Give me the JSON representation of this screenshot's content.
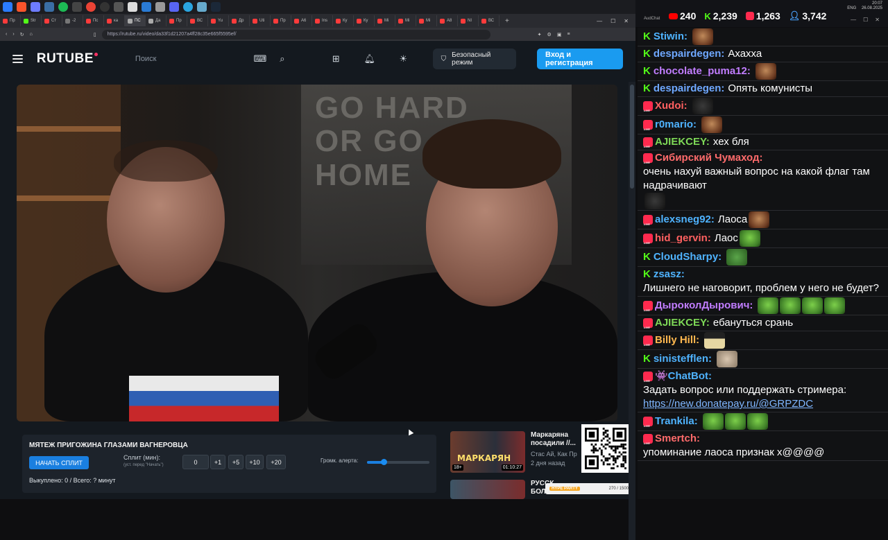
{
  "browser": {
    "tabs": [
      {
        "label": "Пр",
        "color": "#ff3b3b"
      },
      {
        "label": "Str",
        "color": "#53fc18"
      },
      {
        "label": "Ст",
        "color": "#ff3b3b"
      },
      {
        "label": "-2",
        "color": "#777777"
      },
      {
        "label": "Пс",
        "color": "#ff3b3b"
      },
      {
        "label": "ка",
        "color": "#ff3b3b"
      },
      {
        "label": "ПС",
        "color": "#aaaaaa",
        "active": true
      },
      {
        "label": "Да",
        "color": "#aaaaaa"
      },
      {
        "label": "Пр",
        "color": "#ff3b3b"
      },
      {
        "label": "ВС",
        "color": "#ff3b3b"
      },
      {
        "label": "Yu",
        "color": "#ff3b3b"
      },
      {
        "label": "Др",
        "color": "#ff3b3b"
      },
      {
        "label": "Uti",
        "color": "#ff3b3b"
      },
      {
        "label": "Пр",
        "color": "#ff3b3b"
      },
      {
        "label": "А6",
        "color": "#ff3b3b"
      },
      {
        "label": "Ins",
        "color": "#ff3b3b"
      },
      {
        "label": "Ку",
        "color": "#ff3b3b"
      },
      {
        "label": "Ку",
        "color": "#ff3b3b"
      },
      {
        "label": "Mi",
        "color": "#ff3b3b"
      },
      {
        "label": "Mi",
        "color": "#ff3b3b"
      },
      {
        "label": "Mi",
        "color": "#ff3b3b"
      },
      {
        "label": "А8",
        "color": "#ff3b3b"
      },
      {
        "label": "NI",
        "color": "#ff3b3b"
      },
      {
        "label": "ВС",
        "color": "#ff3b3b"
      }
    ],
    "new_tab": "+",
    "url": "https://rutube.ru/video/da33f1d21207a4ff28c35e665f5595ef/"
  },
  "rutube": {
    "logo": "RUTUBE",
    "search_placeholder": "Поиск",
    "safe_mode": "Безопасный режим",
    "login": "Вход и регистрация",
    "poster_text": "GO HARD\nOR GO\nHOME"
  },
  "split": {
    "title": "МЯТЕЖ ПРИГОЖИНА ГЛАЗАМИ ВАГНЕРОВЦА",
    "start": "НАЧАТЬ СПЛИТ",
    "label": "Сплит (мин):",
    "hint": "(уст. перед \"Начать\")",
    "value": "0",
    "buttons": [
      "+1",
      "+5",
      "+10",
      "+20"
    ],
    "alert_label": "Громк. алерта:",
    "alert_volume": 0.27,
    "status": "Выкуплено: 0 / Всего: ? минут"
  },
  "recommendation": {
    "title": "Маркаряна посадили //...",
    "author": "Стас Ай, Как Пр",
    "ago": "2 дня назад",
    "thumb_text": "МАРКАРЯН",
    "age_badge": "18+",
    "duration": "01:10:27",
    "title2": "РУССК\nБОЛ"
  },
  "hype": {
    "tag": "HYPE PARTY",
    "progress": "270 / 1500"
  },
  "system": {
    "time": "20:07",
    "date": "26.08.2025",
    "lang": "ENG"
  },
  "chat_window_title": "AudChat",
  "stats": {
    "youtube": "240",
    "kick": "2,239",
    "vk": "1,263",
    "total": "3,742"
  },
  "chat": [
    {
      "platform": "kick",
      "user": "Stiwin:",
      "color": "#4fb3ff",
      "text": "",
      "emotes": [
        "face"
      ]
    },
    {
      "platform": "kick",
      "user": "despairdegen:",
      "color": "#6fa8ff",
      "text": "Ахахха",
      "emotes": []
    },
    {
      "platform": "kick",
      "user": "chocolate_puma12:",
      "color": "#c17dff",
      "text": "",
      "emotes": [
        "face"
      ]
    },
    {
      "platform": "kick",
      "user": "despairdegen:",
      "color": "#6fa8ff",
      "text": "Опять комунисты",
      "emotes": []
    },
    {
      "platform": "vk",
      "user": "Xudoi:",
      "color": "#ff6060",
      "text": "",
      "emotes": [
        "ball"
      ]
    },
    {
      "platform": "vk",
      "user": "r0mario:",
      "color": "#4fb3ff",
      "text": "",
      "emotes": [
        "face"
      ]
    },
    {
      "platform": "vk",
      "user": "AJIEKCEY:",
      "color": "#7ed957",
      "text": "хех бля",
      "emotes": []
    },
    {
      "platform": "vk",
      "user": "Сибирский Чумаход:",
      "color": "#ff6b6b",
      "text": "очень нахуй важный вопрос на какой флаг там надрачивают",
      "emotes": [
        "ball"
      ]
    },
    {
      "platform": "vk",
      "user": "alexsneg92:",
      "color": "#4fb3ff",
      "text": "Лаоса",
      "emotes": [
        "face"
      ]
    },
    {
      "platform": "vk",
      "user": "hid_gervin:",
      "color": "#ff6060",
      "text": "Лаос",
      "emotes": [
        "frog"
      ]
    },
    {
      "platform": "kick",
      "user": "CloudSharpy:",
      "color": "#4fb3ff",
      "text": "",
      "emotes": [
        "pepe"
      ]
    },
    {
      "platform": "kick",
      "user": "zsasz:",
      "color": "#4fb3ff",
      "text": "Лишнего не наговорит, проблем у него не будет?",
      "emotes": []
    },
    {
      "platform": "vk",
      "user": "ДыроколДырович:",
      "color": "#c17dff",
      "text": "",
      "emotes": [
        "frog",
        "frog",
        "frog",
        "frog"
      ]
    },
    {
      "platform": "vk",
      "user": "AJIEKCEY:",
      "color": "#7ed957",
      "text": "ебануться срань",
      "emotes": []
    },
    {
      "platform": "vk",
      "user": "Billy Hill:",
      "color": "#ffb84f",
      "text": "",
      "emotes": [
        "hat"
      ]
    },
    {
      "platform": "kick",
      "user": "sinistefflen:",
      "color": "#4fb3ff",
      "text": "",
      "emotes": [
        "cat"
      ]
    },
    {
      "platform": "vk",
      "user": "👾ChatBot:",
      "color": "#4fb3ff",
      "text": "Задать вопрос или поддержать стримера:",
      "link": "https://new.donatepay.ru/@GRPZDC",
      "emotes": []
    },
    {
      "platform": "vk",
      "user": "Trankila:",
      "color": "#4fb3ff",
      "text": "",
      "emotes": [
        "frog",
        "frog",
        "frog"
      ]
    },
    {
      "platform": "vk",
      "user": "Smertch:",
      "color": "#ff6b6b",
      "text": "упоминание лаоса признак х@@@@",
      "emotes": []
    }
  ]
}
